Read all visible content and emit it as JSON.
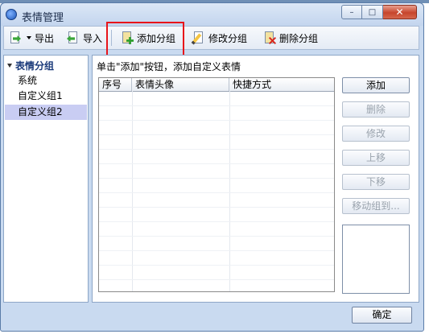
{
  "window": {
    "title": "表情管理",
    "close_glyph": "✕",
    "minimize_glyph": "–",
    "maximize_glyph": "□"
  },
  "toolbar": {
    "export_label": "导出",
    "import_label": "导入",
    "add_group_label": "添加分组",
    "edit_group_label": "修改分组",
    "delete_group_label": "删除分组"
  },
  "tree": {
    "root_label": "表情分组",
    "items": [
      {
        "label": "系统",
        "selected": false
      },
      {
        "label": "自定义组1",
        "selected": false
      },
      {
        "label": "自定义组2",
        "selected": true
      }
    ]
  },
  "main": {
    "hint": "单击\"添加\"按钮，添加自定义表情",
    "columns": [
      "序号",
      "表情头像",
      "快捷方式"
    ]
  },
  "actions": {
    "add": "添加",
    "delete": "删除",
    "edit": "修改",
    "move_up": "上移",
    "move_down": "下移",
    "move_to_group": "移动组到..."
  },
  "footer": {
    "ok_label": "确定"
  },
  "colors": {
    "highlight": "#e8141a",
    "selected_row": "#c9cdf3",
    "accent": "#1a3a7a"
  }
}
